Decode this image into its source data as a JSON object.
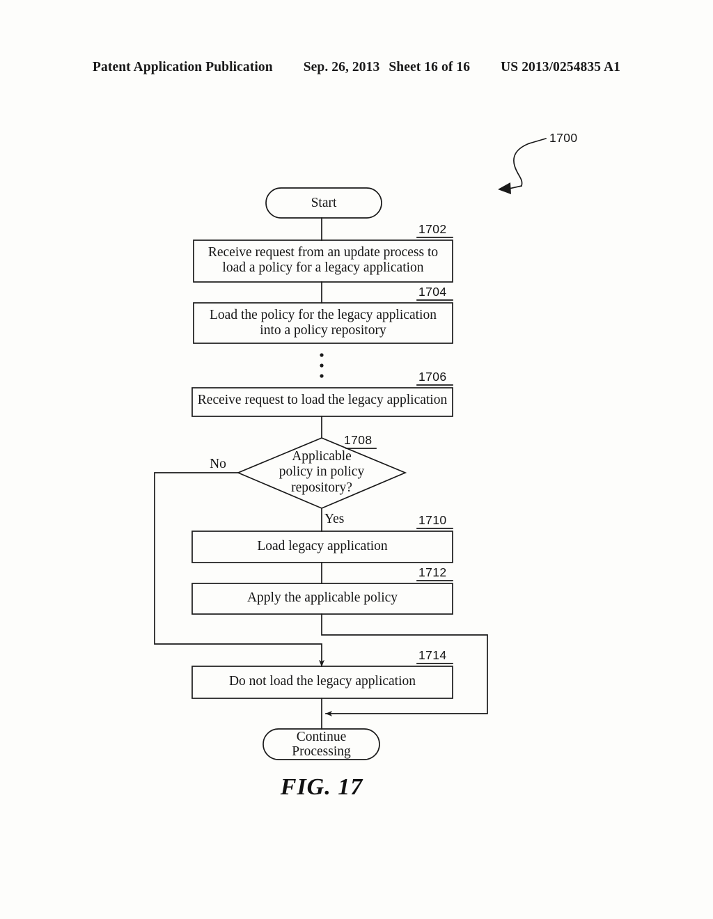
{
  "header": {
    "publication": "Patent Application Publication",
    "date": "Sep. 26, 2013",
    "sheet": "Sheet 16 of 16",
    "patent_number": "US 2013/0254835 A1"
  },
  "figure": {
    "caption": "FIG. 17",
    "diagram_ref": "1700",
    "type": "flowchart"
  },
  "nodes": {
    "start": {
      "label": "Start",
      "shape": "terminator"
    },
    "n1702": {
      "ref": "1702",
      "label": "Receive request from an update process to\nload a policy for a legacy application",
      "shape": "process"
    },
    "n1704": {
      "ref": "1704",
      "label": "Load the policy for the legacy application\ninto a policy repository",
      "shape": "process"
    },
    "ellipsis": {
      "label": "vertical-ellipsis"
    },
    "n1706": {
      "ref": "1706",
      "label": "Receive request to load the legacy application",
      "shape": "process"
    },
    "n1708": {
      "ref": "1708",
      "label": "Applicable\npolicy in policy\nrepository?",
      "shape": "decision"
    },
    "n1710": {
      "ref": "1710",
      "label": "Load legacy application",
      "shape": "process"
    },
    "n1712": {
      "ref": "1712",
      "label": "Apply the applicable policy",
      "shape": "process"
    },
    "n1714": {
      "ref": "1714",
      "label": "Do not load the legacy application",
      "shape": "process"
    },
    "end": {
      "label": "Continue\nProcessing",
      "shape": "terminator"
    }
  },
  "branches": {
    "no": "No",
    "yes": "Yes"
  },
  "colors": {
    "ink": "#1a1a1a",
    "paper": "#fdfdfb"
  }
}
